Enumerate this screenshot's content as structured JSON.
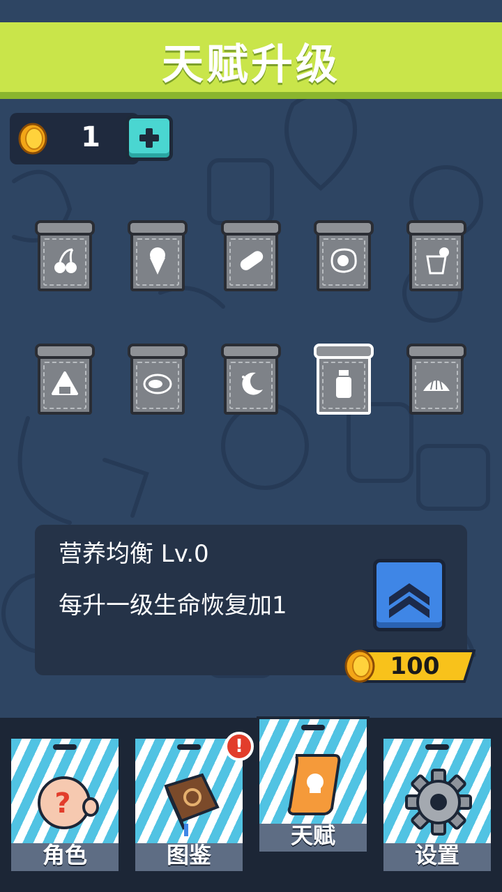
{
  "header": {
    "title": "天赋升级"
  },
  "currency": {
    "coins": "1"
  },
  "talents": [
    {
      "icon": "cherry-icon"
    },
    {
      "icon": "ice-cream-icon"
    },
    {
      "icon": "bread-icon"
    },
    {
      "icon": "fried-egg-icon"
    },
    {
      "icon": "juice-cup-icon"
    },
    {
      "icon": "rice-ball-icon"
    },
    {
      "icon": "steak-icon"
    },
    {
      "icon": "moon-icon"
    },
    {
      "icon": "milk-bottle-icon",
      "selected": true
    },
    {
      "icon": "croissant-icon"
    }
  ],
  "info": {
    "title": "营养均衡 Lv.0",
    "description": "每升一级生命恢复加1",
    "cost": "100"
  },
  "nav": [
    {
      "label": "角色",
      "icon": "character-icon"
    },
    {
      "label": "图鉴",
      "icon": "book-icon",
      "badge": "!"
    },
    {
      "label": "天赋",
      "icon": "scroll-icon",
      "active": true
    },
    {
      "label": "设置",
      "icon": "gear-icon"
    }
  ],
  "colors": {
    "background": "#2e4563",
    "header": "#c9e54a",
    "accent": "#3f86e6"
  }
}
